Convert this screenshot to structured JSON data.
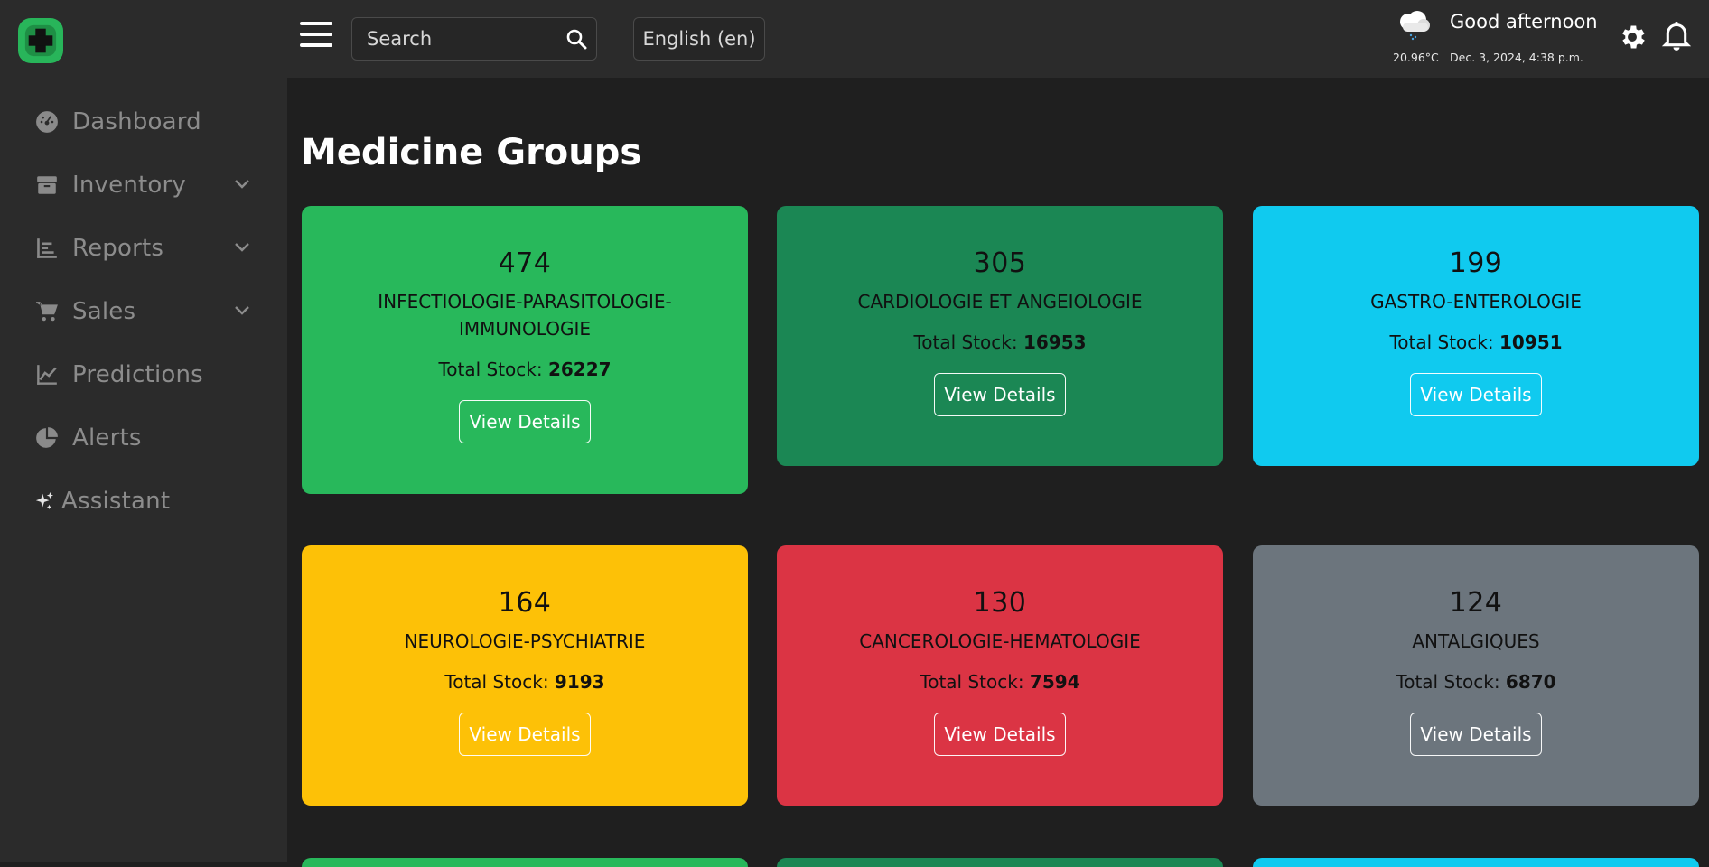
{
  "app": {
    "logo_icon": "pharmacy-cross-icon",
    "brand_color": "#28b55a"
  },
  "sidebar": {
    "items": [
      {
        "label": "Dashboard",
        "icon": "speedometer-icon",
        "has_chevron": false
      },
      {
        "label": "Inventory",
        "icon": "box-icon",
        "has_chevron": true
      },
      {
        "label": "Reports",
        "icon": "bar-chart-icon",
        "has_chevron": true
      },
      {
        "label": "Sales",
        "icon": "cart-icon",
        "has_chevron": true
      },
      {
        "label": "Predictions",
        "icon": "line-chart-icon",
        "has_chevron": false
      },
      {
        "label": "Alerts",
        "icon": "pie-chart-icon",
        "has_chevron": false
      },
      {
        "label": "Assistant",
        "icon": "sparkles-icon",
        "has_chevron": false
      }
    ]
  },
  "topbar": {
    "search_placeholder": "Search",
    "language": "English (en)",
    "weather_temp": "20.96°C",
    "greeting": "Good afternoon",
    "datetime": "Dec. 3, 2024, 4:38 p.m."
  },
  "main": {
    "title": "Medicine Groups",
    "stock_label": "Total Stock:",
    "button_label": "View Details",
    "groups": [
      {
        "count": "474",
        "name": "INFECTIOLOGIE-PARASITOLOGIE-IMMUNOLOGIE",
        "stock": "26227",
        "color": "#28b85b"
      },
      {
        "count": "305",
        "name": "CARDIOLOGIE ET ANGEIOLOGIE",
        "stock": "16953",
        "color": "#1b8754"
      },
      {
        "count": "199",
        "name": "GASTRO-ENTEROLOGIE",
        "stock": "10951",
        "color": "#10caef"
      },
      {
        "count": "164",
        "name": "NEUROLOGIE-PSYCHIATRIE",
        "stock": "9193",
        "color": "#fdc107"
      },
      {
        "count": "130",
        "name": "CANCEROLOGIE-HEMATOLOGIE",
        "stock": "7594",
        "color": "#db3444"
      },
      {
        "count": "124",
        "name": "ANTALGIQUES",
        "stock": "6870",
        "color": "#6c757d"
      }
    ]
  }
}
